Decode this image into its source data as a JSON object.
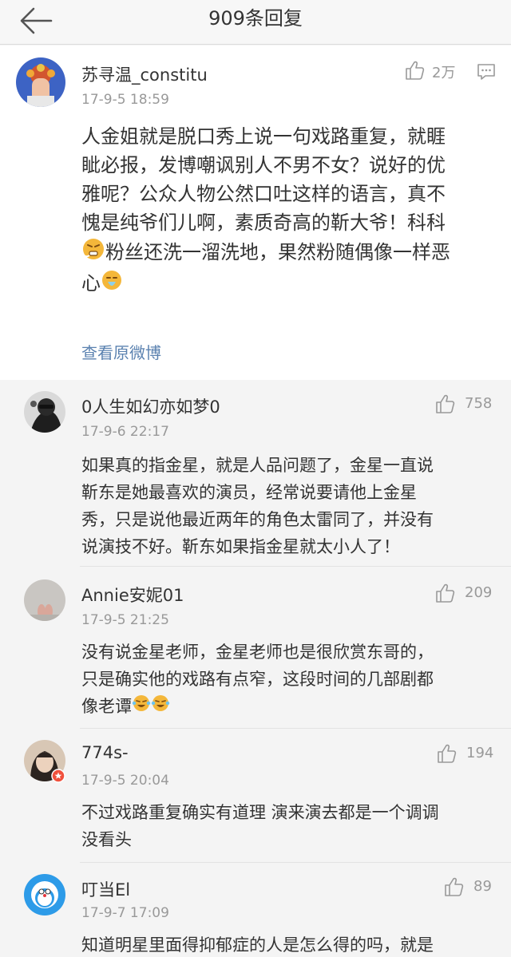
{
  "header": {
    "title": "909条回复"
  },
  "post": {
    "username": "苏寻温_constitu",
    "time": "17-9-5 18:59",
    "likes": "2万",
    "lines": [
      "人金姐就是脱口秀上说一句戏路重复，就睚",
      "眦必报，发博嘲讽别人不男不女？说好的优",
      "雅呢？公众人物公然口吐这样的语言，真不",
      "愧是纯爷们儿啊，素质奇高的靳大爷！科科",
      "粉丝还洗一溜洗地，果然粉随偶像一样恶",
      "心"
    ],
    "view_original": "查看原微博"
  },
  "comments": [
    {
      "username": "0人生如幻亦如梦0",
      "time": "17-9-6 22:17",
      "likes": "758",
      "lines": [
        "如果真的指金星，就是人品问题了，金星一直说",
        "靳东是她最喜欢的演员，经常说要请他上金星",
        "秀，只是说他最近两年的角色太雷同了，并没有",
        "说演技不好。靳东如果指金星就太小人了！"
      ]
    },
    {
      "username": "Annie安妮01",
      "time": "17-9-5 21:25",
      "likes": "209",
      "lines": [
        "没有说金星老师，金星老师也是很欣赏东哥的，",
        "只是确实他的戏路有点窄，这段时间的几部剧都",
        "像老谭"
      ]
    },
    {
      "username": "774s-",
      "time": "17-9-5 20:04",
      "likes": "194",
      "lines": [
        "不过戏路重复确实有道理 演来演去都是一个调调",
        "没看头"
      ]
    },
    {
      "username": "叮当El",
      "time": "17-9-7 17:09",
      "likes": "89",
      "lines": [
        "知道明星里面得抑郁症的人是怎么得的吗，就是"
      ]
    }
  ]
}
